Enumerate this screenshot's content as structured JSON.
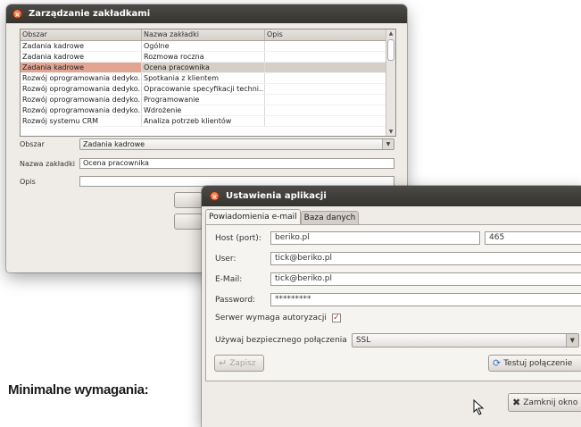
{
  "window1": {
    "title": "Zarządzanie zakładkami",
    "columns": [
      "Obszar",
      "Nazwa zakładki",
      "Opis"
    ],
    "rows": [
      [
        "Zadania kadrowe",
        "Ogólne",
        ""
      ],
      [
        "Zadania kadrowe",
        "Rozmowa roczna",
        ""
      ],
      [
        "Zadania kadrowe",
        "Ocena pracownika",
        ""
      ],
      [
        "Rozwój oprogramowania dedyko...",
        "Spotkania z klientem",
        ""
      ],
      [
        "Rozwój oprogramowania dedyko...",
        "Opracowanie specyfikacji techni...",
        ""
      ],
      [
        "Rozwój oprogramowania dedyko...",
        "Programowanie",
        ""
      ],
      [
        "Rozwój oprogramowania dedyko...",
        "Wdrożenie",
        ""
      ],
      [
        "Rozwój systemu CRM",
        "Analiza potrzeb klientów",
        ""
      ]
    ],
    "selected_row": 2,
    "form": {
      "area_label": "Obszar",
      "area_value": "Zadania kadrowe",
      "name_label": "Nazwa zakładki",
      "name_value": "Ocena pracownika",
      "desc_label": "Opis",
      "desc_value": ""
    }
  },
  "window2": {
    "title": "Ustawienia aplikacji",
    "tabs": [
      "Powiadomienia e-mail",
      "Baza danych"
    ],
    "host_label": "Host (port):",
    "host_value": "beriko.pl",
    "port_value": "465",
    "user_label": "User:",
    "user_value": "tick@beriko.pl",
    "email_label": "E-Mail:",
    "email_value": "tick@beriko.pl",
    "password_label": "Password:",
    "password_value": "*********",
    "auth_label": "Serwer wymaga autoryzacji",
    "auth_checked": true,
    "secure_label": "Używaj bezpiecznego połączenia",
    "secure_value": "SSL",
    "save_label": "Zapisz",
    "test_label": "Testuj połączenie",
    "close_label": "Zamknij okno"
  },
  "caption": "Minimalne wymagania:",
  "colors": {
    "titlebar": "#3b3a36",
    "close": "#d5471b",
    "selection": "#e2a592",
    "window": "#efebe7"
  }
}
